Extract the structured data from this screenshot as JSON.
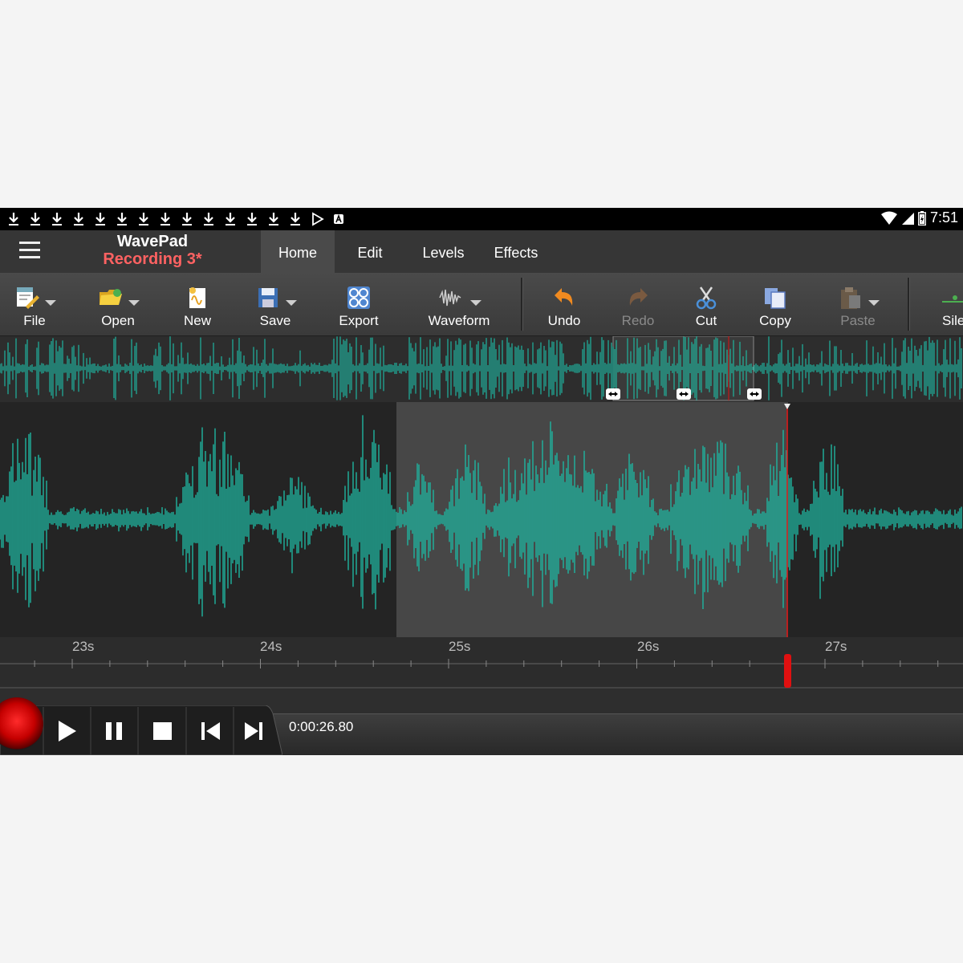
{
  "status_bar": {
    "notification_icons": [
      "download-icon",
      "download-icon",
      "download-icon",
      "download-icon",
      "download-icon",
      "download-icon",
      "download-icon",
      "download-icon",
      "download-icon",
      "download-icon",
      "download-icon",
      "download-icon",
      "download-icon",
      "download-icon",
      "play-store-icon",
      "text-a-icon"
    ],
    "clock": "7:51"
  },
  "header": {
    "app_title": "WavePad",
    "file_name": "Recording 3*",
    "tabs": [
      {
        "label": "Home",
        "active": true
      },
      {
        "label": "Edit"
      },
      {
        "label": "Levels"
      },
      {
        "label": "Effects"
      }
    ]
  },
  "toolbar": {
    "file": "File",
    "open": "Open",
    "new": "New",
    "save": "Save",
    "export": "Export",
    "waveform": "Waveform",
    "undo": "Undo",
    "redo": "Redo",
    "cut": "Cut",
    "copy": "Copy",
    "paste": "Paste",
    "silence": "Sile"
  },
  "timeline": {
    "ticks": [
      "23s",
      "24s",
      "25s",
      "26s",
      "27s"
    ]
  },
  "transport": {
    "time": "0:00:26.80"
  },
  "colors": {
    "waveform": "#1fb5a0",
    "playhead": "#e01010",
    "file_name": "#ff6262"
  }
}
